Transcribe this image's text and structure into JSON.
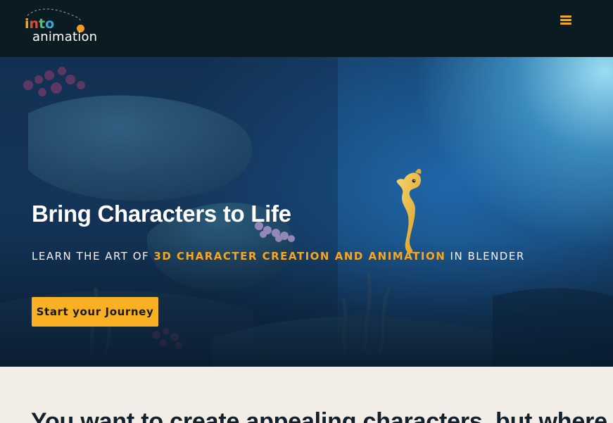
{
  "header": {
    "logo": {
      "line1": [
        "i",
        "n",
        "t",
        "o"
      ],
      "line2": "animation"
    },
    "menu_icon": "hamburger-icon"
  },
  "hero": {
    "title": "Bring Characters to Life",
    "subtitle_pre": "LEARN THE ART OF ",
    "subtitle_highlight": "3D CHARACTER CREATION AND ANIMATION",
    "subtitle_post": " IN BLENDER",
    "cta_label": "Start your Journey"
  },
  "intro": {
    "heading": "You want to create appealing characters, but where"
  },
  "colors": {
    "header_bg": "#0b1b22",
    "accent": "#f9b022",
    "highlight": "#f5a623",
    "section_bg": "#f2ede6",
    "heading_text": "#14212b"
  }
}
